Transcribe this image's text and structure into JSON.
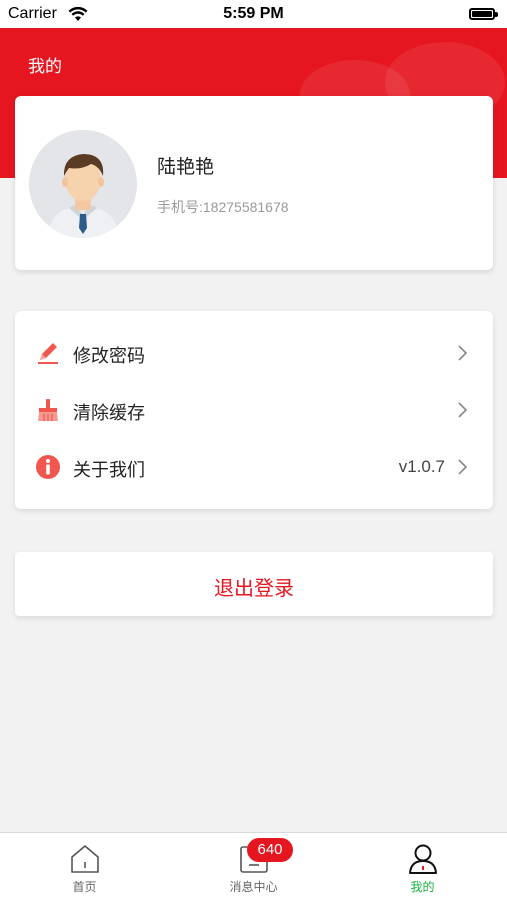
{
  "status_bar": {
    "carrier": "Carrier",
    "time": "5:59 PM",
    "wifi_icon": "wifi-icon",
    "battery_icon": "battery-icon"
  },
  "header": {
    "title": "我的",
    "background_color": "#e5161f"
  },
  "profile": {
    "avatar_icon": "user-avatar-icon",
    "name": "陆艳艳",
    "phone": "手机号:18275581678"
  },
  "menu": {
    "items": [
      {
        "label": "修改密码",
        "icon": "pencil-icon",
        "value": ""
      },
      {
        "label": "清除缓存",
        "icon": "broom-icon",
        "value": ""
      },
      {
        "label": "关于我们",
        "icon": "info-icon",
        "value": "v1.0.7"
      }
    ],
    "chevron_icon": "chevron-right-icon"
  },
  "logout": {
    "label": "退出登录"
  },
  "tabbar": {
    "tabs": [
      {
        "label": "首页",
        "icon": "home-icon",
        "active": false
      },
      {
        "label": "消息中心",
        "icon": "message-icon",
        "active": false,
        "badge": "640"
      },
      {
        "label": "我的",
        "icon": "person-icon",
        "active": true
      }
    ],
    "active_color": "#19b23b",
    "badge_color": "#e5161f"
  }
}
